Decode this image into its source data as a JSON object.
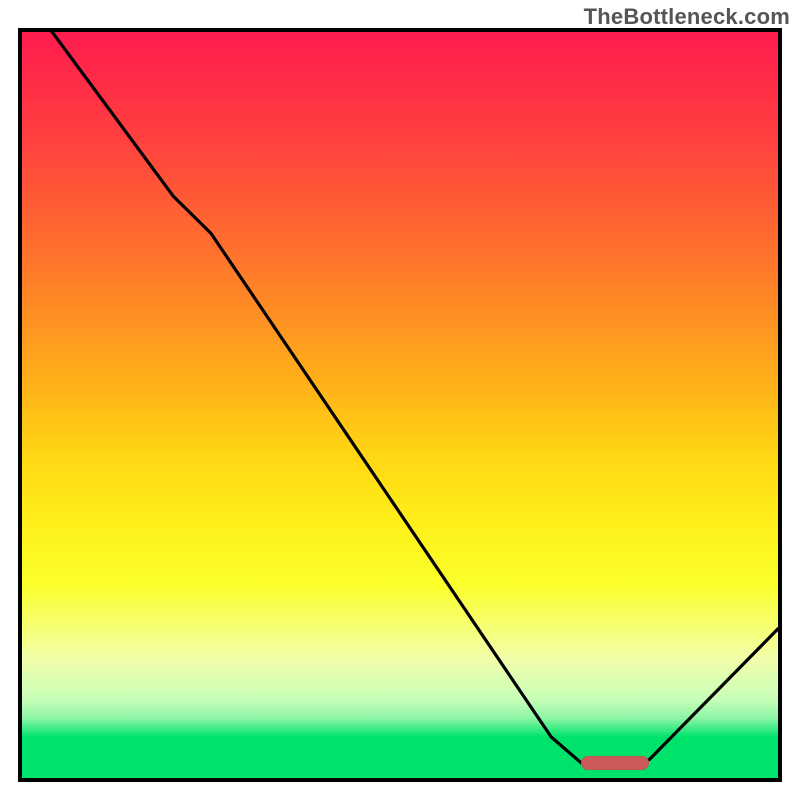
{
  "watermark": "TheBottleneck.com",
  "colors": {
    "gradient_top": "#ff1c4f",
    "gradient_bottom": "#00e36b",
    "frame": "#000000",
    "curve": "#000000",
    "marker": "#cc5a5a"
  },
  "chart_data": {
    "type": "line",
    "title": "",
    "xlabel": "",
    "ylabel": "",
    "xlim": [
      0,
      100
    ],
    "ylim": [
      0,
      100
    ],
    "x": [
      0,
      4,
      20,
      25,
      70,
      74,
      82,
      83,
      100
    ],
    "values": [
      103,
      100,
      78,
      73,
      5.5,
      2,
      2,
      2.5,
      20
    ],
    "marker": {
      "x_start": 74,
      "x_end": 83,
      "y": 2
    },
    "notes": "y expressed as percentage of plot height from bottom; values above 100 indicate the curve enters from above the top edge"
  }
}
